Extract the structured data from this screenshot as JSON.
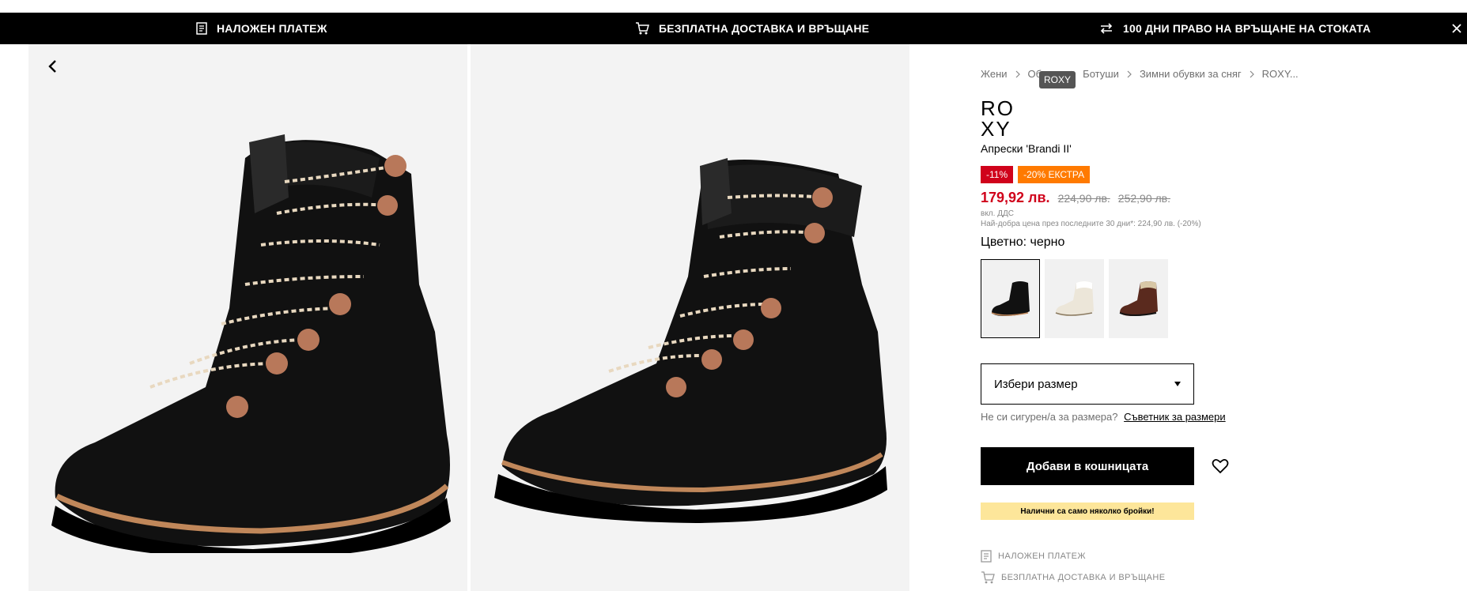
{
  "promo": {
    "items": [
      {
        "icon": "receipt-icon",
        "label": "НАЛОЖЕН ПЛАТЕЖ"
      },
      {
        "icon": "cart-icon",
        "label": "БЕЗПЛАТНА ДОСТАВКА И ВРЪЩАНЕ"
      },
      {
        "icon": "exchange-icon",
        "label": "100 ДНИ ПРАВО НА ВРЪЩАНЕ НА СТОКАТА"
      }
    ],
    "close_icon": "close-icon"
  },
  "breadcrumb": [
    {
      "label": "Жени"
    },
    {
      "label": "Обувки"
    },
    {
      "label": "Ботуши"
    },
    {
      "label": "Зимни обувки за сняг"
    },
    {
      "label": "ROXY..."
    }
  ],
  "tooltip": "ROXY",
  "brand": {
    "line1": "RO",
    "line2": "XY"
  },
  "product": {
    "name": "Апрески 'Brandi II'",
    "badges": [
      {
        "label": "-11%",
        "color": "#d0021b"
      },
      {
        "label": "-20% ЕКСТРА",
        "color": "#ff7a00"
      }
    ],
    "price_now": "179,92 лв.",
    "price_old_1": "224,90 лв.",
    "price_old_2": "252,90 лв.",
    "vat": "вкл. ДДС",
    "best_price": "Най-добра цена през последните 30 дни*: 224,90 лв. (-20%)",
    "color_label": "Цветно: черно",
    "swatches": [
      {
        "name": "black"
      },
      {
        "name": "white"
      },
      {
        "name": "brown"
      }
    ],
    "size_placeholder": "Избери размер",
    "size_question": "Не си сигурен/а за размера?",
    "size_advisor": "Съветник за размери",
    "add_to_cart": "Добави в кошницата",
    "stock_note": "Налични са само няколко бройки!"
  },
  "info": [
    {
      "icon": "receipt-icon",
      "label": "НАЛОЖЕН ПЛАТЕЖ"
    },
    {
      "icon": "cart-icon",
      "label": "БЕЗПЛАТНА ДОСТАВКА И ВРЪЩАНЕ"
    }
  ],
  "colors": {
    "sale": "#d0021b",
    "extra": "#ff7a00",
    "stock_bg": "#fde69a"
  }
}
